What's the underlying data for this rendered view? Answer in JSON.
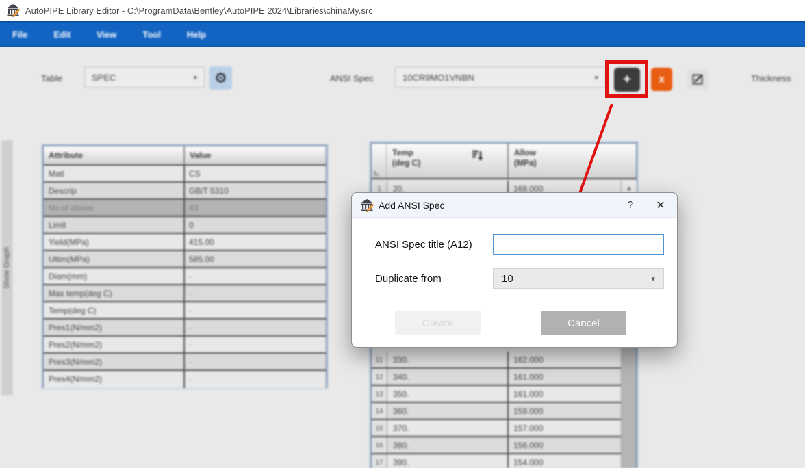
{
  "window": {
    "title": "AutoPIPE Library Editor - C:\\ProgramData\\Bentley\\AutoPIPE 2024\\Libraries\\chinaMy.src",
    "app_icon": "autopipe-library-icon"
  },
  "menu": {
    "items": [
      "File",
      "Edit",
      "View",
      "Tool",
      "Help"
    ]
  },
  "toolbar": {
    "table_label": "Table",
    "table_select_value": "SPEC",
    "settings_icon": "gear-icon",
    "ansi_spec_label": "ANSI Spec",
    "ansi_spec_select_value": "10CR9MO1VNBN",
    "add_button_label": "+",
    "delete_button_label": "X",
    "edit_icon": "pencil-square-icon",
    "thickness_label": "Thickness"
  },
  "side_panel": {
    "show_graph_label": "Show Graph"
  },
  "attribute_table": {
    "headers": [
      "Attribute",
      "Value"
    ],
    "rows": [
      {
        "attribute": "Matl",
        "value": "CS"
      },
      {
        "attribute": "Descrip",
        "value": "GB/T 5310"
      },
      {
        "attribute": "No of allows",
        "value": "43",
        "disabled": true
      },
      {
        "attribute": "Limit",
        "value": "0"
      },
      {
        "attribute": "Yield(MPa)",
        "value": "415.00"
      },
      {
        "attribute": "Ultim(MPa)",
        "value": "585.00"
      },
      {
        "attribute": "Diam(mm)",
        "value": "-"
      },
      {
        "attribute": "Max temp(deg C)",
        "value": "-"
      },
      {
        "attribute": "Temp(deg C)",
        "value": "-"
      },
      {
        "attribute": "Pres1(N/mm2)",
        "value": "-"
      },
      {
        "attribute": "Pres2(N/mm2)",
        "value": "-"
      },
      {
        "attribute": "Pres3(N/mm2)",
        "value": "-"
      },
      {
        "attribute": "Pres4(N/mm2)",
        "value": "-"
      }
    ]
  },
  "allow_table": {
    "temp_header": "Temp\n(deg C)",
    "allow_header": "Allow\n(MPa)",
    "sort_icon": "sort-filter-icon",
    "visible_rows": [
      {
        "n": 1,
        "temp": "20.",
        "allow": "168.000"
      },
      {
        "n": 11,
        "temp": "330.",
        "allow": "162.000"
      },
      {
        "n": 12,
        "temp": "340.",
        "allow": "161.000"
      },
      {
        "n": 13,
        "temp": "350.",
        "allow": "161.000"
      },
      {
        "n": 14,
        "temp": "360.",
        "allow": "159.000"
      },
      {
        "n": 15,
        "temp": "370.",
        "allow": "157.000"
      },
      {
        "n": 16,
        "temp": "380.",
        "allow": "156.000"
      },
      {
        "n": 17,
        "temp": "390.",
        "allow": "154.000"
      }
    ]
  },
  "dialog": {
    "title": "Add ANSI Spec",
    "help_button": "?",
    "close_button": "✕",
    "fields": {
      "title_label": "ANSI Spec title (A12)",
      "title_value": "",
      "duplicate_label": "Duplicate from",
      "duplicate_value": "10"
    },
    "buttons": {
      "create": "Create",
      "cancel": "Cancel"
    },
    "create_enabled": false
  },
  "annotations": {
    "highlight_color": "#e01212",
    "arrow_color": "#e01212",
    "note": "red box highlights add button, arrow points to dialog"
  },
  "colors": {
    "menubar_blue": "#1263c2",
    "delete_orange": "#e95d13",
    "focus_border_blue": "#4f96d8"
  }
}
